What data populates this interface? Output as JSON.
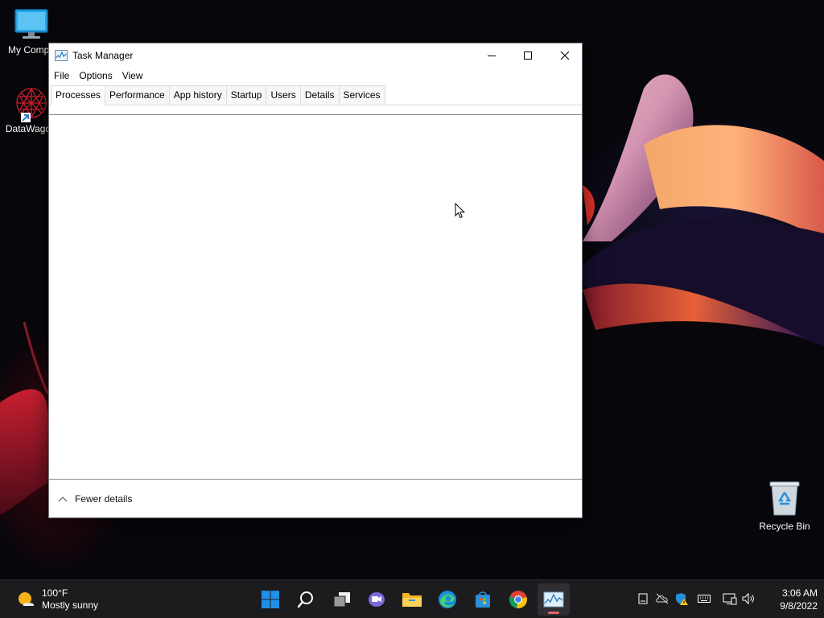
{
  "desktop": {
    "icons": [
      {
        "label": "My Compu"
      },
      {
        "label": "DataWagor"
      }
    ],
    "recycle_bin": {
      "label": "Recycle Bin"
    }
  },
  "window": {
    "title": "Task Manager",
    "controls": {
      "minimize": "minimize-icon",
      "maximize": "maximize-icon",
      "close": "close-icon"
    },
    "menu": [
      {
        "label": "File"
      },
      {
        "label": "Options"
      },
      {
        "label": "View"
      }
    ],
    "tabs": [
      {
        "label": "Processes",
        "active": true
      },
      {
        "label": "Performance"
      },
      {
        "label": "App history"
      },
      {
        "label": "Startup"
      },
      {
        "label": "Users"
      },
      {
        "label": "Details"
      },
      {
        "label": "Services"
      }
    ],
    "footer": {
      "label": "Fewer details",
      "icon": "chevron-up-icon"
    }
  },
  "taskbar": {
    "weather": {
      "temperature": "100°F",
      "condition": "Mostly sunny",
      "icon": "sun-cloud-icon"
    },
    "apps": [
      {
        "name": "start-button",
        "icon": "windows-logo-icon"
      },
      {
        "name": "search-button",
        "icon": "search-icon"
      },
      {
        "name": "task-view-button",
        "icon": "task-view-icon"
      },
      {
        "name": "chat-button",
        "icon": "chat-icon"
      },
      {
        "name": "file-explorer-button",
        "icon": "folder-icon"
      },
      {
        "name": "edge-button",
        "icon": "edge-icon"
      },
      {
        "name": "store-button",
        "icon": "store-icon"
      },
      {
        "name": "chrome-button",
        "icon": "chrome-icon"
      },
      {
        "name": "task-manager-button",
        "icon": "task-manager-icon",
        "active": true
      }
    ],
    "clock": {
      "time": "3:06 AM",
      "date": "9/8/2022"
    }
  },
  "colors": {
    "taskbar_bg": "#1c1c1f",
    "window_bg": "#ffffff",
    "windows_blue": "#1f8fe8",
    "active_indicator": "#e06a6a"
  }
}
